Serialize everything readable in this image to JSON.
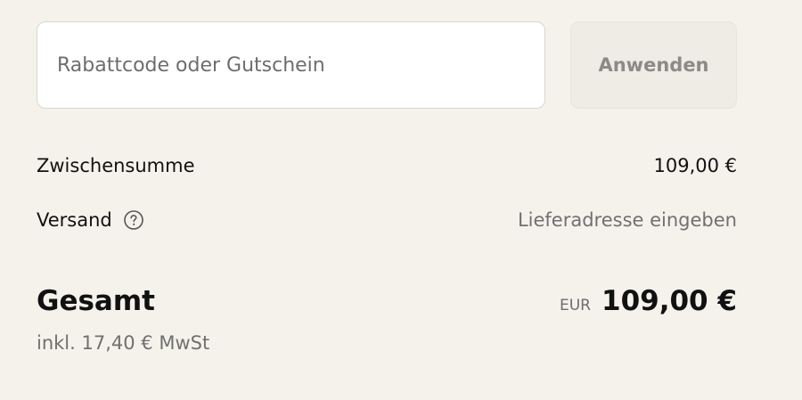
{
  "discount": {
    "placeholder": "Rabattcode oder Gutschein",
    "value": "",
    "apply_label": "Anwenden"
  },
  "summary": {
    "subtotal_label": "Zwischensumme",
    "subtotal_value": "109,00 €",
    "shipping_label": "Versand",
    "shipping_icon": "help-circle-icon",
    "shipping_value": "Lieferadresse eingeben",
    "total_label": "Gesamt",
    "currency_code": "EUR",
    "total_value": "109,00 €",
    "tax_note": "inkl. 17,40 € MwSt"
  },
  "colors": {
    "background": "#f5f2ec",
    "text": "#111111",
    "muted_text": "#707070",
    "input_border": "#d8d5d0",
    "button_background": "#efebe5",
    "button_text": "#8c8a87"
  }
}
